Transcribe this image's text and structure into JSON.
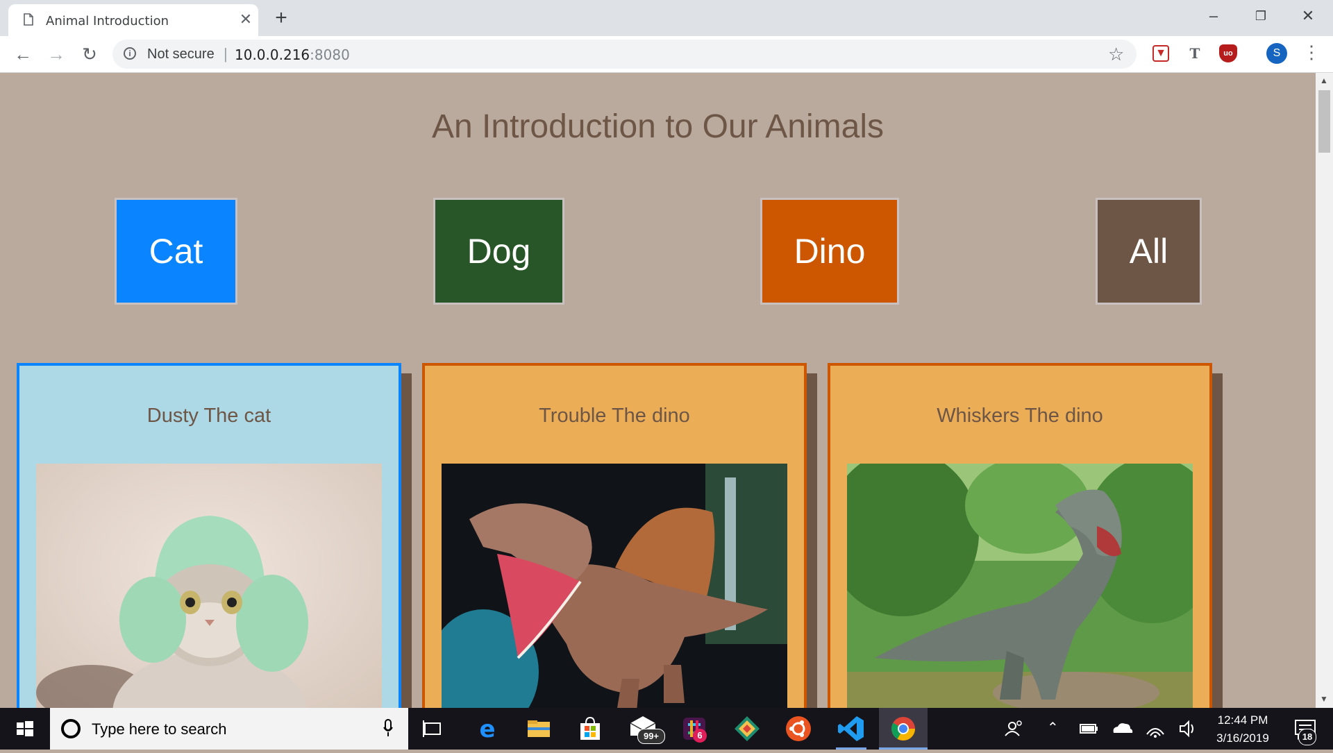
{
  "browser": {
    "tab_title": "Animal Introduction",
    "tab_close": "✕",
    "new_tab": "+",
    "security_label": "Not secure",
    "url_host": "10.0.0.216",
    "url_port": ":8080",
    "profile_initial": "S",
    "window_controls": {
      "minimize": "–",
      "restore": "❐",
      "close": "✕"
    }
  },
  "page": {
    "title": "An Introduction to Our Animals",
    "filters": [
      {
        "label": "Cat",
        "color": "#0a84ff"
      },
      {
        "label": "Dog",
        "color": "#285628"
      },
      {
        "label": "Dino",
        "color": "#cd5700"
      },
      {
        "label": "All",
        "color": "#6d5646"
      }
    ],
    "cards": [
      {
        "title": "Dusty The cat",
        "type": "cat",
        "bg": "#add8e6",
        "border": "#0a84ff"
      },
      {
        "title": "Trouble The dino",
        "type": "dino",
        "bg": "#ecad57",
        "border": "#cd5700"
      },
      {
        "title": "Whiskers The dino",
        "type": "dino",
        "bg": "#ecad57",
        "border": "#cd5700"
      }
    ]
  },
  "taskbar": {
    "search_placeholder": "Type here to search",
    "mail_badge": "99+",
    "slack_badge": "6",
    "time": "12:44 PM",
    "date": "3/16/2019",
    "notification_count": "18"
  }
}
